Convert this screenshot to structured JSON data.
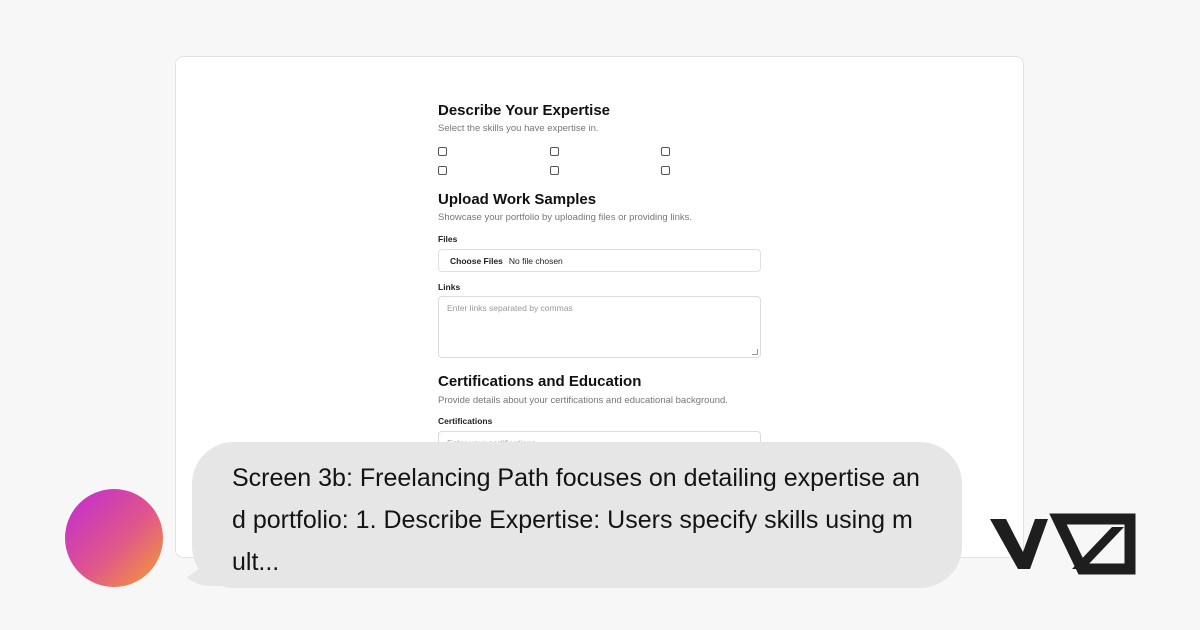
{
  "expertise": {
    "title": "Describe Your Expertise",
    "description": "Select the skills you have expertise in."
  },
  "work_samples": {
    "title": "Upload Work Samples",
    "description": "Showcase your portfolio by uploading files or providing links.",
    "files_label": "Files",
    "choose_files_label": "Choose Files",
    "no_file_text": "No file chosen",
    "links_label": "Links",
    "links_placeholder": "Enter links separated by commas"
  },
  "certifications": {
    "title": "Certifications and Education",
    "description": "Provide details about your certifications and educational background.",
    "cert_label": "Certifications",
    "cert_placeholder": "Enter your certifications"
  },
  "caption": {
    "text": "Screen 3b: Freelancing Path focuses on detailing expertise and portfolio: 1. Describe Expertise: Users specify skills using mult..."
  },
  "colors": {
    "avatar_gradient": [
      "#c02ad6",
      "#e0568a",
      "#f5a030"
    ],
    "bubble": "#e6e6e6",
    "logo": "#1e1e1e"
  },
  "icons": {
    "logo": "vz-logo-icon"
  }
}
